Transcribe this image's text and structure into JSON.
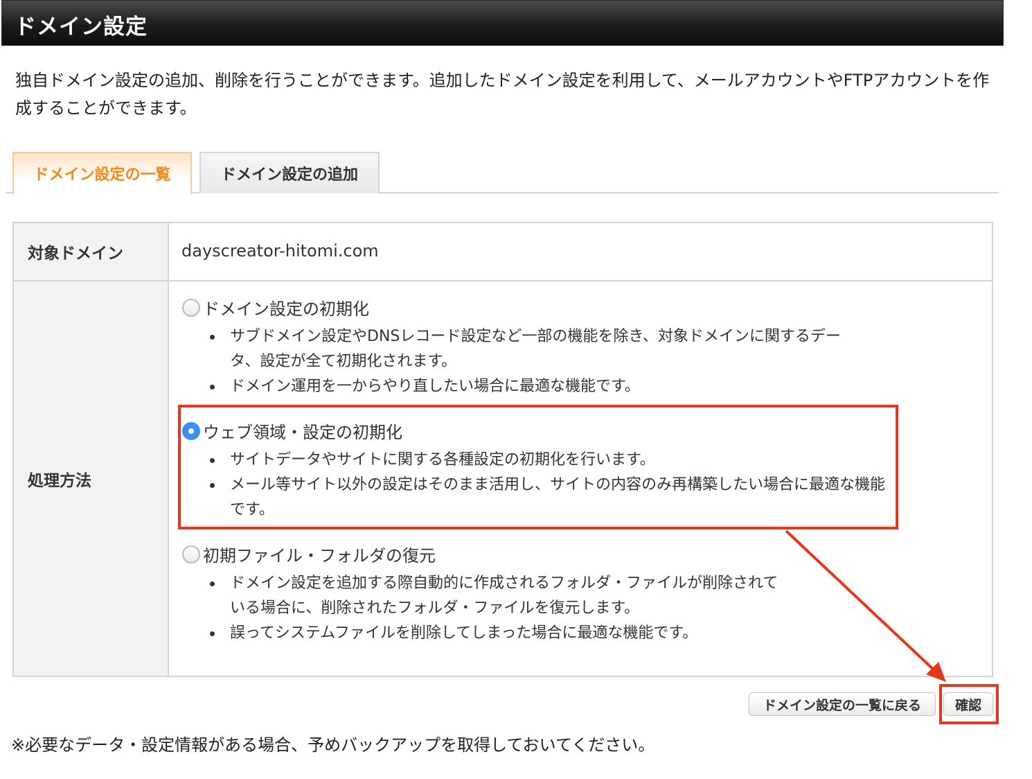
{
  "header": {
    "title": "ドメイン設定"
  },
  "intro": {
    "text": "独自ドメイン設定の追加、削除を行うことができます。追加したドメイン設定を利用して、メールアカウントやFTPアカウントを作成することができます。"
  },
  "tabs": [
    {
      "label": "ドメイン設定の一覧",
      "active": true
    },
    {
      "label": "ドメイン設定の追加",
      "active": false
    }
  ],
  "table": {
    "target_domain_label": "対象ドメイン",
    "target_domain_value": "dayscreator-hitomi.com",
    "method_label": "処理方法",
    "options": [
      {
        "label": "ドメイン設定の初期化",
        "checked": false,
        "bullets": [
          "サブドメイン設定やDNSレコード設定など一部の機能を除き、対象ドメインに関するデータ、設定が全て初期化されます。",
          "ドメイン運用を一からやり直したい場合に最適な機能です。"
        ]
      },
      {
        "label": "ウェブ領域・設定の初期化",
        "checked": true,
        "bullets": [
          "サイトデータやサイトに関する各種設定の初期化を行います。",
          "メール等サイト以外の設定はそのまま活用し、サイトの内容のみ再構築したい場合に最適な機能です。"
        ]
      },
      {
        "label": "初期ファイル・フォルダの復元",
        "checked": false,
        "bullets": [
          "ドメイン設定を追加する際自動的に作成されるフォルダ・ファイルが削除されている場合に、削除されたフォルダ・ファイルを復元します。",
          "誤ってシステムファイルを削除してしまった場合に最適な機能です。"
        ]
      }
    ]
  },
  "buttons": {
    "back_label": "ドメイン設定の一覧に戻る",
    "confirm_label": "確認"
  },
  "footnote": "※必要なデータ・設定情報がある場合、予めバックアップを取得しておいてください。",
  "colors": {
    "active_tab": "#f28a1b",
    "highlight": "#e8361c",
    "radio_checked": "#3b8ff0"
  }
}
